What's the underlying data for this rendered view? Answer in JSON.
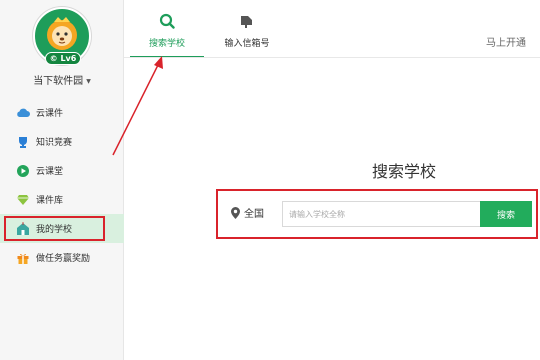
{
  "sidebar": {
    "level_badge": "Lv6",
    "school_name": "当下软件园",
    "items": [
      {
        "label": "云课件",
        "icon": "cloud-icon",
        "color": "#3a8fd8"
      },
      {
        "label": "知识竞赛",
        "icon": "trophy-icon",
        "color": "#2a7fd6"
      },
      {
        "label": "云课堂",
        "icon": "play-icon",
        "color": "#23a45a"
      },
      {
        "label": "课件库",
        "icon": "diamond-icon",
        "color": "#8cc43f"
      },
      {
        "label": "我的学校",
        "icon": "school-icon",
        "color": "#3aa7a0",
        "active": true
      },
      {
        "label": "做任务赢奖励",
        "icon": "gift-icon",
        "color": "#f08a1c"
      }
    ]
  },
  "tabs": [
    {
      "label": "搜索学校",
      "icon": "search-icon",
      "active": true
    },
    {
      "label": "输入信箱号",
      "icon": "mailbox-icon",
      "active": false
    }
  ],
  "header": {
    "join_text": "马上开通"
  },
  "main": {
    "title": "搜索学校",
    "region": "全国",
    "search_placeholder": "请输入学校全称",
    "search_button": "搜索"
  },
  "colors": {
    "accent": "#1e9d5a",
    "annotation": "#d9232b",
    "active_bg": "#d9f0df"
  }
}
